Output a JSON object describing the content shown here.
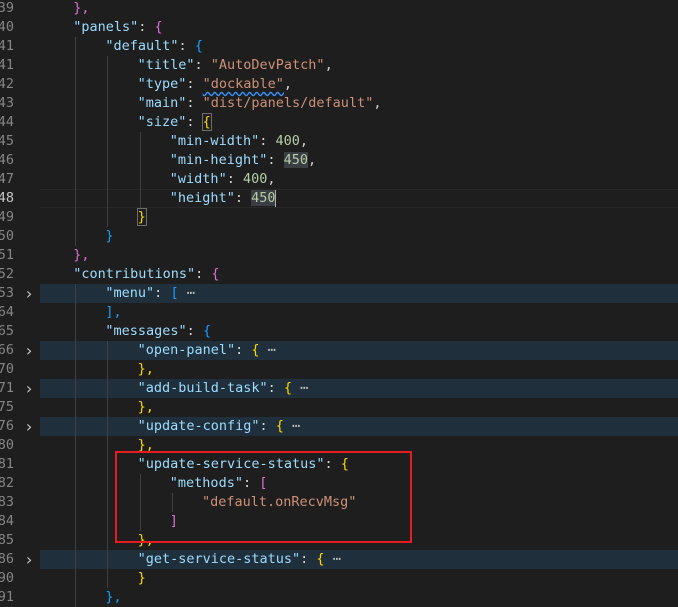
{
  "editor": {
    "lines": [
      {
        "num": "39",
        "folded": false,
        "indent": 2,
        "tokens": [
          {
            "t": "},",
            "c": "b2"
          }
        ]
      },
      {
        "num": "40",
        "folded": false,
        "indent": 2,
        "tokens": [
          {
            "t": "\"panels\"",
            "c": "k"
          },
          {
            "t": ": ",
            "c": "p"
          },
          {
            "t": "{",
            "c": "b2"
          }
        ]
      },
      {
        "num": "41",
        "folded": false,
        "indent": 4,
        "tokens": [
          {
            "t": "\"default\"",
            "c": "k"
          },
          {
            "t": ": ",
            "c": "p"
          },
          {
            "t": "{",
            "c": "b3"
          }
        ]
      },
      {
        "num": "41",
        "folded": false,
        "indent": 6,
        "tokens": [
          {
            "t": "\"title\"",
            "c": "k"
          },
          {
            "t": ": ",
            "c": "p"
          },
          {
            "t": "\"AutoDevPatch\"",
            "c": "s"
          },
          {
            "t": ",",
            "c": "p"
          }
        ]
      },
      {
        "num": "42",
        "folded": false,
        "indent": 6,
        "tokens": [
          {
            "t": "\"type\"",
            "c": "k"
          },
          {
            "t": ": ",
            "c": "p"
          },
          {
            "t": "\"dockable\"",
            "c": "s squiggle"
          },
          {
            "t": ",",
            "c": "p"
          }
        ]
      },
      {
        "num": "43",
        "folded": false,
        "indent": 6,
        "tokens": [
          {
            "t": "\"main\"",
            "c": "k"
          },
          {
            "t": ": ",
            "c": "p"
          },
          {
            "t": "\"dist/panels/default\"",
            "c": "s"
          },
          {
            "t": ",",
            "c": "p"
          }
        ]
      },
      {
        "num": "44",
        "folded": false,
        "indent": 6,
        "tokens": [
          {
            "t": "\"size\"",
            "c": "k"
          },
          {
            "t": ": ",
            "c": "p"
          },
          {
            "t": "{",
            "c": "b1 bm"
          }
        ]
      },
      {
        "num": "45",
        "folded": false,
        "indent": 8,
        "tokens": [
          {
            "t": "\"min-width\"",
            "c": "k"
          },
          {
            "t": ": ",
            "c": "p"
          },
          {
            "t": "400",
            "c": "n"
          },
          {
            "t": ",",
            "c": "p"
          }
        ]
      },
      {
        "num": "46",
        "folded": false,
        "indent": 8,
        "tokens": [
          {
            "t": "\"min-height\"",
            "c": "k"
          },
          {
            "t": ": ",
            "c": "p"
          },
          {
            "t": "450",
            "c": "n hl"
          },
          {
            "t": ",",
            "c": "p"
          }
        ]
      },
      {
        "num": "47",
        "folded": false,
        "indent": 8,
        "tokens": [
          {
            "t": "\"width\"",
            "c": "k"
          },
          {
            "t": ": ",
            "c": "p"
          },
          {
            "t": "400",
            "c": "n"
          },
          {
            "t": ",",
            "c": "p"
          }
        ]
      },
      {
        "num": "48",
        "folded": false,
        "indent": 8,
        "current": true,
        "tokens": [
          {
            "t": "\"height\"",
            "c": "k"
          },
          {
            "t": ": ",
            "c": "p"
          },
          {
            "t": "450",
            "c": "n hl"
          },
          {
            "t": "",
            "c": "cursor"
          }
        ]
      },
      {
        "num": "49",
        "folded": false,
        "indent": 6,
        "tokens": [
          {
            "t": "}",
            "c": "b1 bm"
          }
        ]
      },
      {
        "num": "50",
        "folded": false,
        "indent": 4,
        "tokens": [
          {
            "t": "}",
            "c": "b3"
          }
        ]
      },
      {
        "num": "51",
        "folded": false,
        "indent": 2,
        "tokens": [
          {
            "t": "},",
            "c": "b2"
          }
        ]
      },
      {
        "num": "52",
        "folded": false,
        "indent": 2,
        "tokens": [
          {
            "t": "\"contributions\"",
            "c": "k"
          },
          {
            "t": ": ",
            "c": "p"
          },
          {
            "t": "{",
            "c": "b2"
          }
        ]
      },
      {
        "num": "53",
        "folded": true,
        "indent": 4,
        "tokens": [
          {
            "t": "\"menu\"",
            "c": "k"
          },
          {
            "t": ": ",
            "c": "p"
          },
          {
            "t": "[",
            "c": "b3"
          },
          {
            "t": " ⋯",
            "c": "ell"
          }
        ]
      },
      {
        "num": "64",
        "folded": false,
        "indent": 4,
        "tokens": [
          {
            "t": "],",
            "c": "b3"
          }
        ]
      },
      {
        "num": "65",
        "folded": false,
        "indent": 4,
        "tokens": [
          {
            "t": "\"messages\"",
            "c": "k"
          },
          {
            "t": ": ",
            "c": "p"
          },
          {
            "t": "{",
            "c": "b3"
          }
        ]
      },
      {
        "num": "66",
        "folded": true,
        "indent": 6,
        "tokens": [
          {
            "t": "\"open-panel\"",
            "c": "k"
          },
          {
            "t": ": ",
            "c": "p"
          },
          {
            "t": "{",
            "c": "b1"
          },
          {
            "t": " ⋯",
            "c": "ell"
          }
        ]
      },
      {
        "num": "70",
        "folded": false,
        "indent": 6,
        "tokens": [
          {
            "t": "},",
            "c": "b1"
          }
        ]
      },
      {
        "num": "71",
        "folded": true,
        "indent": 6,
        "tokens": [
          {
            "t": "\"add-build-task\"",
            "c": "k"
          },
          {
            "t": ": ",
            "c": "p"
          },
          {
            "t": "{",
            "c": "b1"
          },
          {
            "t": " ⋯",
            "c": "ell"
          }
        ]
      },
      {
        "num": "75",
        "folded": false,
        "indent": 6,
        "tokens": [
          {
            "t": "},",
            "c": "b1"
          }
        ]
      },
      {
        "num": "76",
        "folded": true,
        "indent": 6,
        "tokens": [
          {
            "t": "\"update-config\"",
            "c": "k"
          },
          {
            "t": ": ",
            "c": "p"
          },
          {
            "t": "{",
            "c": "b1"
          },
          {
            "t": " ⋯",
            "c": "ell"
          }
        ]
      },
      {
        "num": "80",
        "folded": false,
        "indent": 6,
        "tokens": [
          {
            "t": "},",
            "c": "b1"
          }
        ]
      },
      {
        "num": "81",
        "folded": false,
        "indent": 6,
        "tokens": [
          {
            "t": "\"update-service-status\"",
            "c": "k"
          },
          {
            "t": ": ",
            "c": "p"
          },
          {
            "t": "{",
            "c": "b1"
          }
        ]
      },
      {
        "num": "82",
        "folded": false,
        "indent": 8,
        "tokens": [
          {
            "t": "\"methods\"",
            "c": "k"
          },
          {
            "t": ": ",
            "c": "p"
          },
          {
            "t": "[",
            "c": "b2"
          }
        ]
      },
      {
        "num": "83",
        "folded": false,
        "indent": 10,
        "tokens": [
          {
            "t": "\"default.onRecvMsg\"",
            "c": "s"
          }
        ]
      },
      {
        "num": "84",
        "folded": false,
        "indent": 8,
        "tokens": [
          {
            "t": "]",
            "c": "b2"
          }
        ]
      },
      {
        "num": "85",
        "folded": false,
        "indent": 6,
        "tokens": [
          {
            "t": "},",
            "c": "b1"
          }
        ]
      },
      {
        "num": "86",
        "folded": true,
        "indent": 6,
        "tokens": [
          {
            "t": "\"get-service-status\"",
            "c": "k"
          },
          {
            "t": ": ",
            "c": "p"
          },
          {
            "t": "{",
            "c": "b1"
          },
          {
            "t": " ⋯",
            "c": "ell"
          }
        ]
      },
      {
        "num": "90",
        "folded": false,
        "indent": 6,
        "tokens": [
          {
            "t": "}",
            "c": "b1"
          }
        ]
      },
      {
        "num": "91",
        "folded": false,
        "indent": 4,
        "tokens": [
          {
            "t": "},",
            "c": "b3"
          }
        ]
      }
    ]
  },
  "colors": {
    "background": "#1e1e1e",
    "key": "#9cdcfe",
    "string": "#ce9178",
    "number": "#b5cea8",
    "annotation_box": "#e51c23"
  }
}
